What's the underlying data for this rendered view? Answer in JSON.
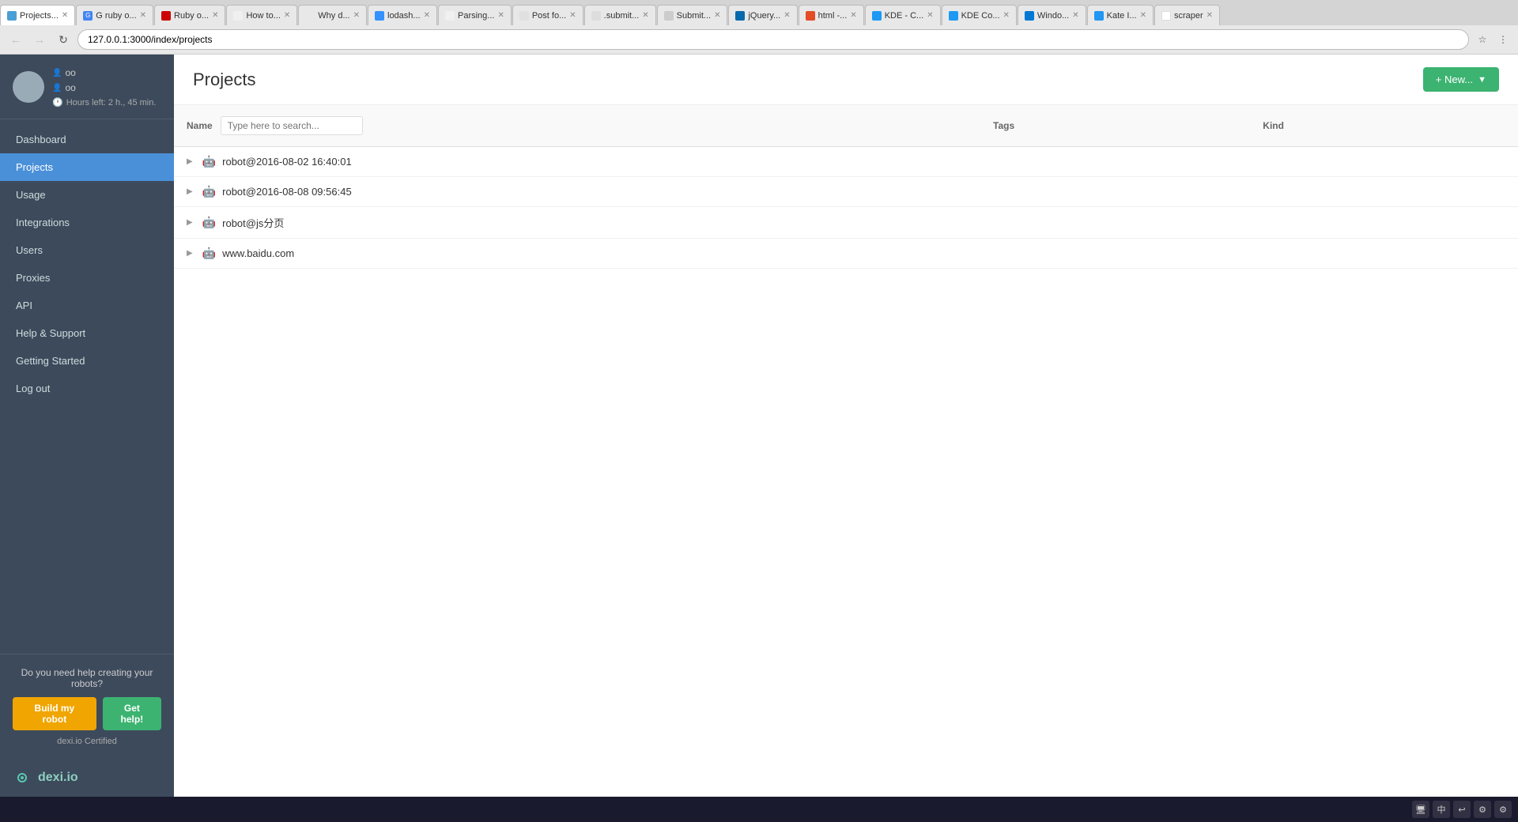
{
  "browser": {
    "address": "127.0.0.1:3000/index/projects",
    "tabs": [
      {
        "id": "projects",
        "label": "Projects...",
        "active": true,
        "favicon": "projects"
      },
      {
        "id": "ruby1",
        "label": "G ruby o...",
        "active": false,
        "favicon": "g"
      },
      {
        "id": "ruby2",
        "label": "Ruby o...",
        "active": false,
        "favicon": "ruby"
      },
      {
        "id": "howto",
        "label": "How to...",
        "active": false,
        "favicon": "how"
      },
      {
        "id": "why",
        "label": "Why d...",
        "active": false,
        "favicon": "why"
      },
      {
        "id": "lodash",
        "label": "lodash...",
        "active": false,
        "favicon": "lodash"
      },
      {
        "id": "parsing",
        "label": "Parsing...",
        "active": false,
        "favicon": "parsing"
      },
      {
        "id": "post",
        "label": "Post fo...",
        "active": false,
        "favicon": "post"
      },
      {
        "id": "submit1",
        "label": ".submit...",
        "active": false,
        "favicon": "submit"
      },
      {
        "id": "submit2",
        "label": "Submit...",
        "active": false,
        "favicon": "submit2"
      },
      {
        "id": "jquery",
        "label": "jQuery...",
        "active": false,
        "favicon": "jquery"
      },
      {
        "id": "html",
        "label": "html -...",
        "active": false,
        "favicon": "html"
      },
      {
        "id": "kde1",
        "label": "KDE - C...",
        "active": false,
        "favicon": "kde"
      },
      {
        "id": "kde2",
        "label": "KDE Co...",
        "active": false,
        "favicon": "kde2"
      },
      {
        "id": "windows",
        "label": "Windo...",
        "active": false,
        "favicon": "windows"
      },
      {
        "id": "kate",
        "label": "Kate I...",
        "active": false,
        "favicon": "kate"
      },
      {
        "id": "scraper",
        "label": "scraper",
        "active": false,
        "favicon": "scraper"
      }
    ]
  },
  "sidebar": {
    "user": {
      "username1": "oo",
      "username2": "oo",
      "hours_label": "Hours left: 2 h., 45 min."
    },
    "nav_items": [
      {
        "id": "dashboard",
        "label": "Dashboard",
        "active": false
      },
      {
        "id": "projects",
        "label": "Projects",
        "active": true
      },
      {
        "id": "usage",
        "label": "Usage",
        "active": false
      },
      {
        "id": "integrations",
        "label": "Integrations",
        "active": false
      },
      {
        "id": "users",
        "label": "Users",
        "active": false
      },
      {
        "id": "proxies",
        "label": "Proxies",
        "active": false
      },
      {
        "id": "api",
        "label": "API",
        "active": false
      },
      {
        "id": "help",
        "label": "Help & Support",
        "active": false
      },
      {
        "id": "getting-started",
        "label": "Getting Started",
        "active": false
      },
      {
        "id": "logout",
        "label": "Log out",
        "active": false
      }
    ],
    "cta": {
      "text": "Do you need help creating your robots?",
      "build_label": "Build my robot",
      "help_label": "Get help!",
      "certified": "dexi.io Certified"
    },
    "logo_text": "dexi.io"
  },
  "main": {
    "title": "Projects",
    "new_button": "+ New...",
    "table": {
      "columns": [
        {
          "id": "name",
          "label": "Name"
        },
        {
          "id": "tags",
          "label": "Tags"
        },
        {
          "id": "kind",
          "label": "Kind"
        }
      ],
      "search_placeholder": "Type here to search...",
      "rows": [
        {
          "name": "robot@2016-08-02 16:40:01",
          "tags": "",
          "kind": ""
        },
        {
          "name": "robot@2016-08-08 09:56:45",
          "tags": "",
          "kind": ""
        },
        {
          "name": "robot@js分页",
          "tags": "",
          "kind": ""
        },
        {
          "name": "www.baidu.com",
          "tags": "",
          "kind": ""
        }
      ]
    }
  },
  "taskbar": {
    "items": [
      "中",
      "↩",
      "⚙",
      "⚙"
    ]
  }
}
